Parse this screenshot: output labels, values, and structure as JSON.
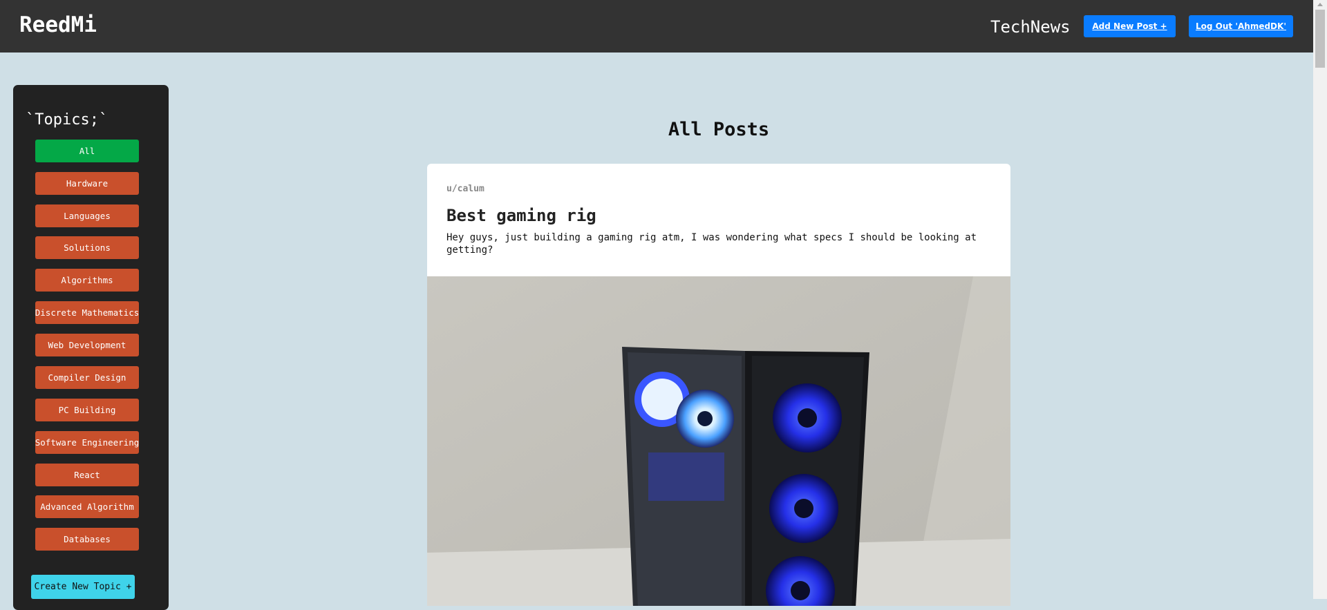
{
  "header": {
    "brand": "ReedMi",
    "site_name": "TechNews",
    "add_post_label": "Add New Post +",
    "logout_label": "Log Out 'AhmedDK'"
  },
  "sidebar": {
    "title": "`Topics;`",
    "topics": [
      {
        "label": "All",
        "active": true
      },
      {
        "label": "Hardware"
      },
      {
        "label": "Languages"
      },
      {
        "label": "Solutions"
      },
      {
        "label": "Algorithms"
      },
      {
        "label": "Discrete Mathematics"
      },
      {
        "label": "Web Development"
      },
      {
        "label": "Compiler Design"
      },
      {
        "label": "PC Building"
      },
      {
        "label": "Software Engineering"
      },
      {
        "label": "React"
      },
      {
        "label": "Advanced Algorithm"
      },
      {
        "label": "Databases"
      }
    ],
    "create_label": "Create New Topic +"
  },
  "main": {
    "heading": "All Posts",
    "posts": [
      {
        "author": "u/calum",
        "title": "Best gaming rig",
        "body": "Hey guys, just building a gaming rig atm, I was wondering what specs I should be looking at getting?",
        "image": "pc-case-photo"
      }
    ]
  },
  "colors": {
    "background": "#cfdfe6",
    "topbar": "#333333",
    "sidebar": "#222222",
    "topic_button": "#c9502c",
    "active_topic": "#04a847",
    "primary_button": "#0a7cff",
    "create_button": "#3fd3ea"
  }
}
